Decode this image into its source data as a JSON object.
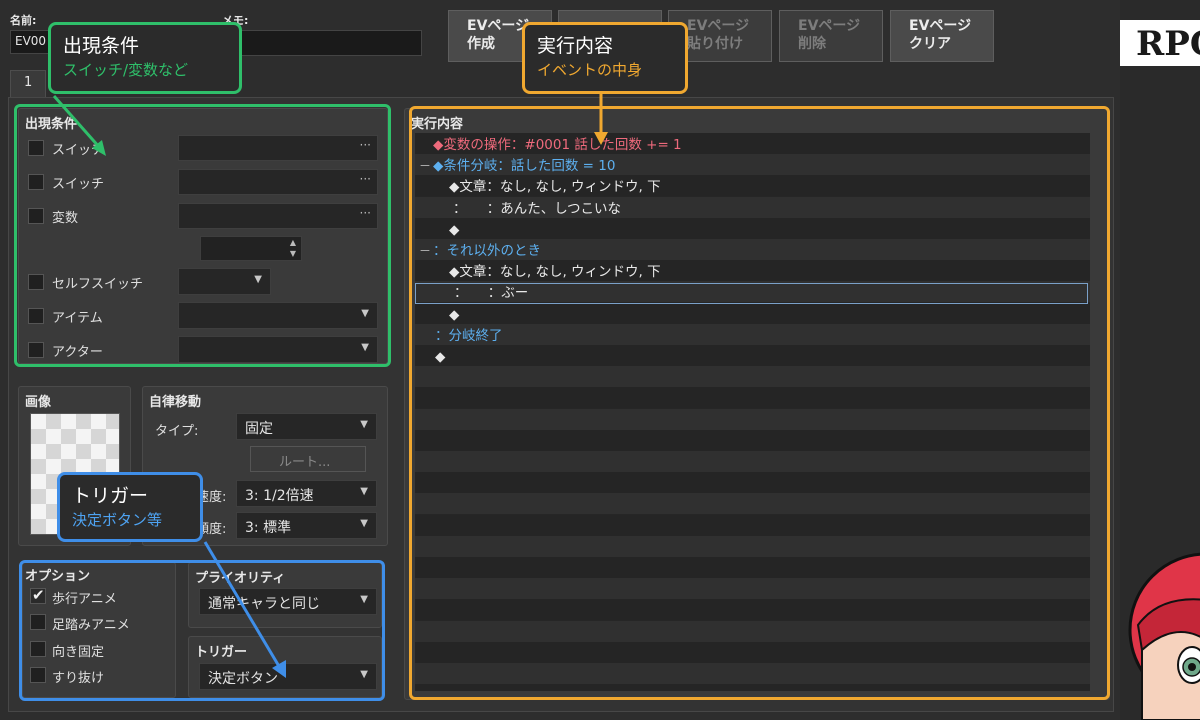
{
  "header": {
    "name_label": "名前:",
    "name_value": "EV00",
    "memo_label": "メモ:"
  },
  "toolbar": {
    "buttons": [
      {
        "line1": "EVページ",
        "line2": "作成",
        "enabled": true
      },
      {
        "line1": "",
        "line2": "",
        "enabled": true
      },
      {
        "line1": "EVページ",
        "line2": "貼り付け",
        "enabled": false
      },
      {
        "line1": "EVページ",
        "line2": "削除",
        "enabled": false
      },
      {
        "line1": "EVページ",
        "line2": "クリア",
        "enabled": true
      }
    ]
  },
  "page_tab": "1",
  "conditions": {
    "title": "出現条件",
    "rows": [
      "スイッチ",
      "スイッチ",
      "変数",
      "セルフスイッチ",
      "アイテム",
      "アクター"
    ]
  },
  "image": {
    "title": "画像"
  },
  "autonomous": {
    "title": "自律移動",
    "type_label": "タイプ:",
    "type_value": "固定",
    "route_button": "ルート...",
    "speed_label": "速度:",
    "speed_value": "3: 1/2倍速",
    "freq_label": "頻度:",
    "freq_value": "3: 標準"
  },
  "options": {
    "title": "オプション",
    "items": [
      {
        "label": "歩行アニメ",
        "checked": true
      },
      {
        "label": "足踏みアニメ",
        "checked": false
      },
      {
        "label": "向き固定",
        "checked": false
      },
      {
        "label": "すり抜け",
        "checked": false
      }
    ]
  },
  "priority": {
    "title": "プライオリティ",
    "value": "通常キャラと同じ"
  },
  "trigger": {
    "title": "トリガー",
    "value": "決定ボタン"
  },
  "contents": {
    "title": "実行内容",
    "lines": [
      {
        "text": "◆変数の操作：#0001 話した回数 += 1",
        "color": "red",
        "indent": 18,
        "fold": ""
      },
      {
        "text": "◆条件分岐：話した回数 = 10",
        "color": "blue",
        "indent": 18,
        "fold": "－"
      },
      {
        "text": "◆文章：なし, なし, ウィンドウ, 下",
        "color": "white",
        "indent": 34,
        "fold": ""
      },
      {
        "text": "：　　：あんた、しつこいな",
        "color": "white",
        "indent": 38,
        "fold": ""
      },
      {
        "text": "◆",
        "color": "white",
        "indent": 34,
        "fold": ""
      },
      {
        "text": "：それ以外のとき",
        "color": "blue",
        "indent": 18,
        "fold": "－"
      },
      {
        "text": "◆文章：なし, なし, ウィンドウ, 下",
        "color": "white",
        "indent": 34,
        "fold": ""
      },
      {
        "text": "：　　：ぶー",
        "color": "white",
        "indent": 38,
        "fold": ""
      },
      {
        "text": "◆",
        "color": "white",
        "indent": 34,
        "fold": ""
      },
      {
        "text": "：分岐終了",
        "color": "blue",
        "indent": 20,
        "fold": ""
      },
      {
        "text": "◆",
        "color": "white",
        "indent": 20,
        "fold": ""
      }
    ],
    "selected_index": 7
  },
  "side": {
    "logo_text": "RPG"
  },
  "callouts": {
    "conditions": {
      "title": "出現条件",
      "sub": "スイッチ/変数など"
    },
    "contents": {
      "title": "実行内容",
      "sub": "イベントの中身"
    },
    "trigger": {
      "title": "トリガー",
      "sub": "決定ボタン等"
    }
  },
  "colors": {
    "green": "#2fbf6a",
    "orange": "#f0a830",
    "blue": "#3f8ee8",
    "cmd_red": "#ee6a7c",
    "cmd_blue": "#5db0f0"
  }
}
